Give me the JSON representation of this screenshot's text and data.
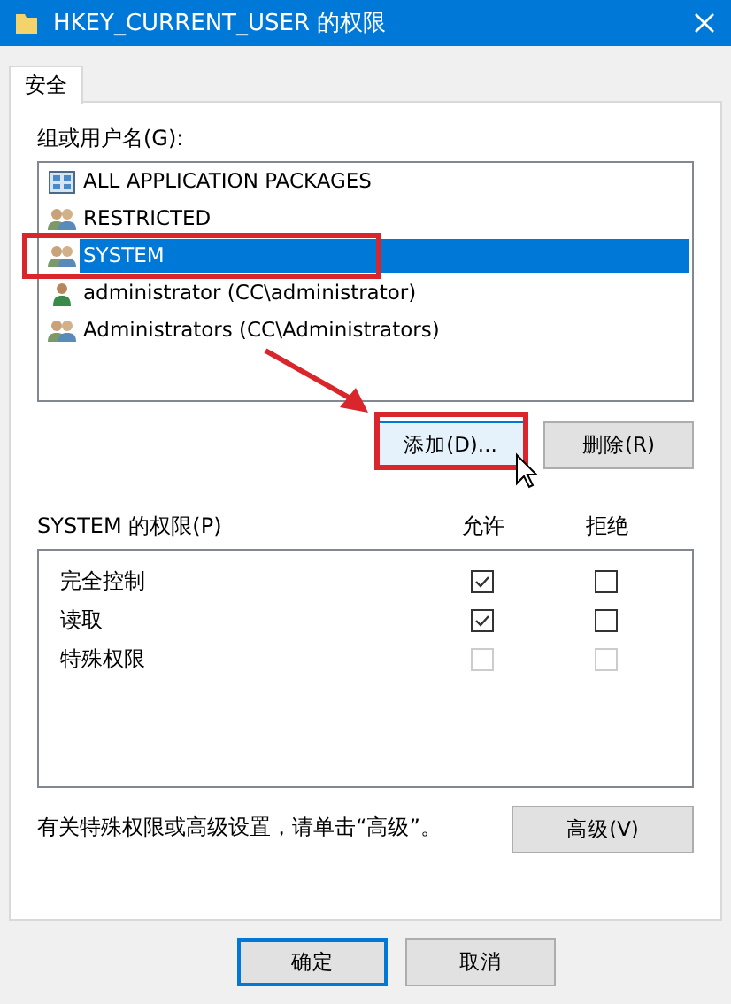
{
  "window": {
    "title": "HKEY_CURRENT_USER 的权限"
  },
  "tabs": [
    {
      "label": "安全",
      "selected": true
    }
  ],
  "users_label": "组或用户名(G):",
  "users": [
    {
      "name": "ALL APPLICATION PACKAGES",
      "kind": "package",
      "selected": false
    },
    {
      "name": "RESTRICTED",
      "kind": "group",
      "selected": false
    },
    {
      "name": "SYSTEM",
      "kind": "group",
      "selected": true
    },
    {
      "name": "administrator (CC\\administrator)",
      "kind": "user",
      "selected": false
    },
    {
      "name": "Administrators (CC\\Administrators)",
      "kind": "group",
      "selected": false
    }
  ],
  "user_buttons": [
    "添加(D)...",
    "删除(R)"
  ],
  "permissions_label": "SYSTEM 的权限(P)",
  "permission_columns": [
    "允许",
    "拒绝"
  ],
  "permissions": [
    {
      "name": "完全控制",
      "allow": {
        "checked": true,
        "disabled": false
      },
      "deny": {
        "checked": false,
        "disabled": false
      }
    },
    {
      "name": "读取",
      "allow": {
        "checked": true,
        "disabled": false
      },
      "deny": {
        "checked": false,
        "disabled": false
      }
    },
    {
      "name": "特殊权限",
      "allow": {
        "checked": false,
        "disabled": true
      },
      "deny": {
        "checked": false,
        "disabled": true
      }
    }
  ],
  "advanced_note": "有关特殊权限或高级设置，请单击“高级”。",
  "advanced_button": "高级(V)",
  "footer_buttons": [
    {
      "label": "确定",
      "default": true
    },
    {
      "label": "取消",
      "default": false
    }
  ]
}
